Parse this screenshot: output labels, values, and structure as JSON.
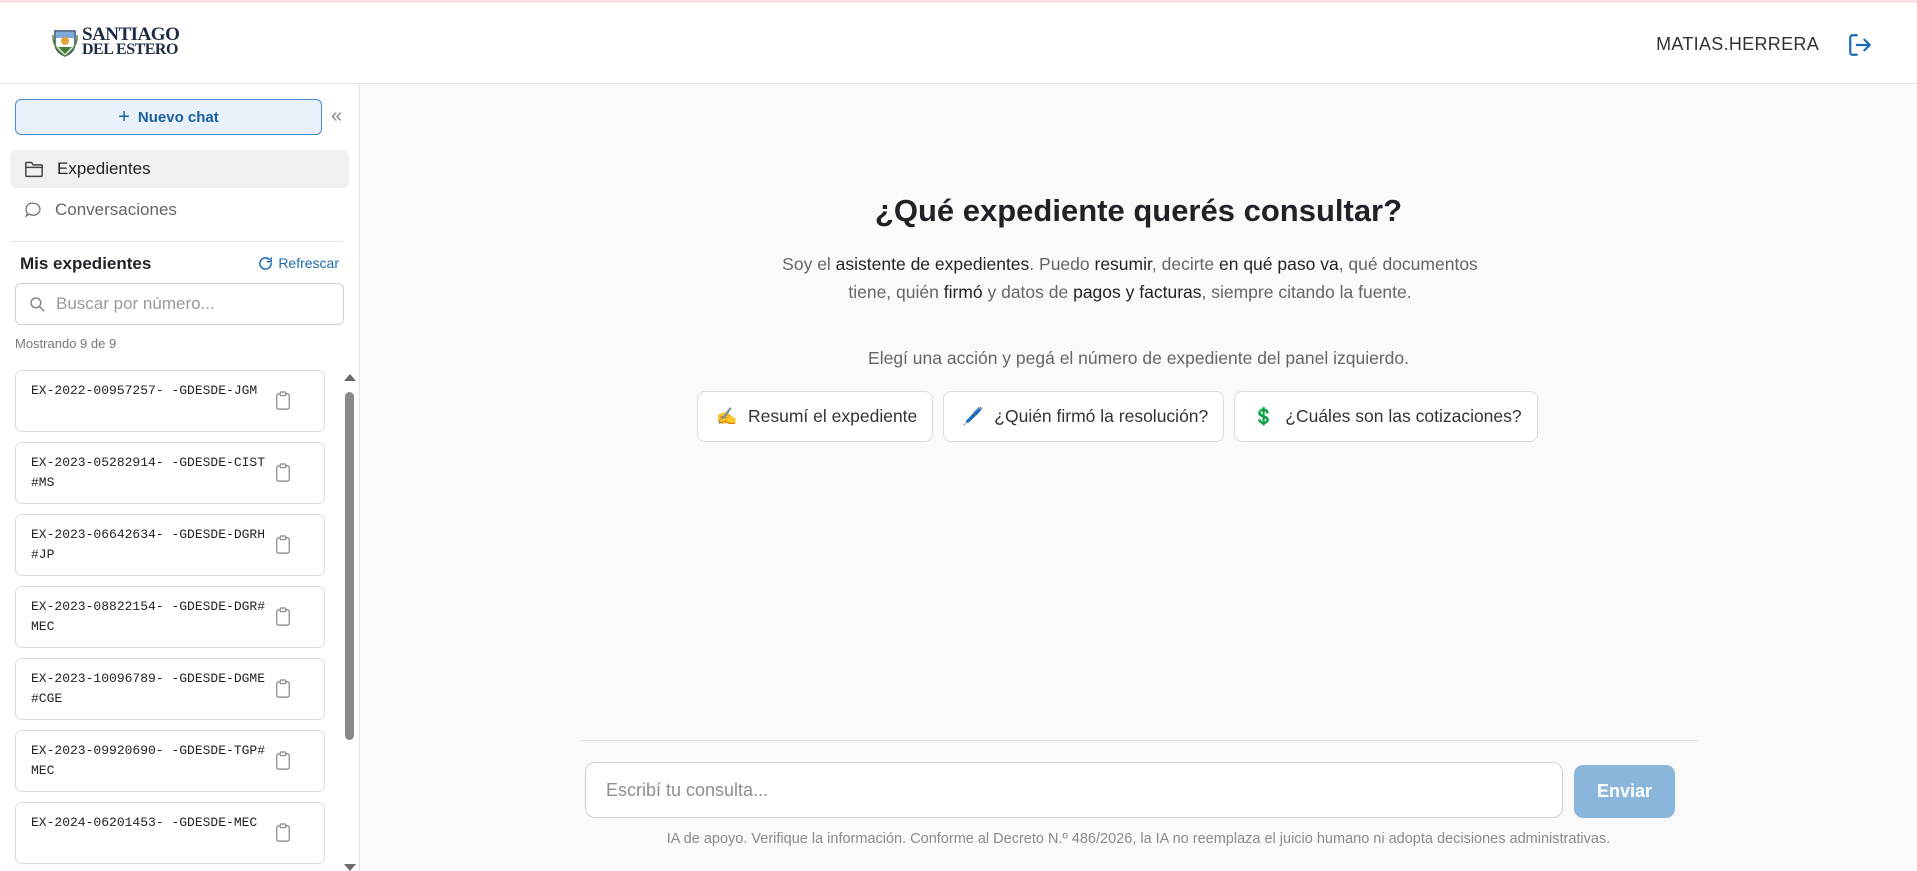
{
  "header": {
    "logo_line1": "SANTIAGO",
    "logo_line2": "DEL ESTERO",
    "username": "MATIAS.HERRERA"
  },
  "sidebar": {
    "new_chat_label": "Nuevo chat",
    "nav": [
      {
        "label": "Expedientes",
        "icon": "folder-icon",
        "active": true
      },
      {
        "label": "Conversaciones",
        "icon": "chat-bubble-icon",
        "active": false
      }
    ],
    "section_title": "Mis expedientes",
    "refresh_label": "Refrescar",
    "search_placeholder": "Buscar por número...",
    "showing_text": "Mostrando 9 de 9",
    "expedientes": [
      "EX-2022-00957257- -GDESDE-JGM",
      "EX-2023-05282914- -GDESDE-CIST#MS",
      "EX-2023-06642634- -GDESDE-DGRH#JP",
      "EX-2023-08822154- -GDESDE-DGR#MEC",
      "EX-2023-10096789- -GDESDE-DGME#CGE",
      "EX-2023-09920690- -GDESDE-TGP#MEC",
      "EX-2024-06201453- -GDESDE-MEC"
    ]
  },
  "main": {
    "title": "¿Qué expediente querés consultar?",
    "desc": {
      "t1": "Soy el ",
      "b1": "asistente de expedientes",
      "t2": ". Puedo ",
      "b2": "resumir",
      "t3": ", decirte ",
      "b3": "en qué paso va",
      "t4": ", qué documentos tiene, quién ",
      "b4": "firmó",
      "t5": " y datos de ",
      "b5": "pagos y facturas",
      "t6": ", siempre citando la fuente."
    },
    "hint": "Elegí una acción y pegá el número de expediente del panel izquierdo.",
    "actions": [
      {
        "emoji": "✍️",
        "label": "Resumí el expediente"
      },
      {
        "emoji": "🖊️",
        "label": "¿Quién firmó la resolución?"
      },
      {
        "emoji": "💲",
        "label": "¿Cuáles son las cotizaciones?"
      }
    ],
    "composer_placeholder": "Escribí tu consulta...",
    "send_label": "Enviar",
    "disclaimer": "IA de apoyo. Verifique la información. Conforme al Decreto N.º 486/2026, la IA no reemplaza el juicio humano ni adopta decisiones administrativas."
  },
  "colors": {
    "accent": "#1c6bb0",
    "send_button": "#8bb6dc",
    "new_chat_bg": "#e8f1fa"
  }
}
